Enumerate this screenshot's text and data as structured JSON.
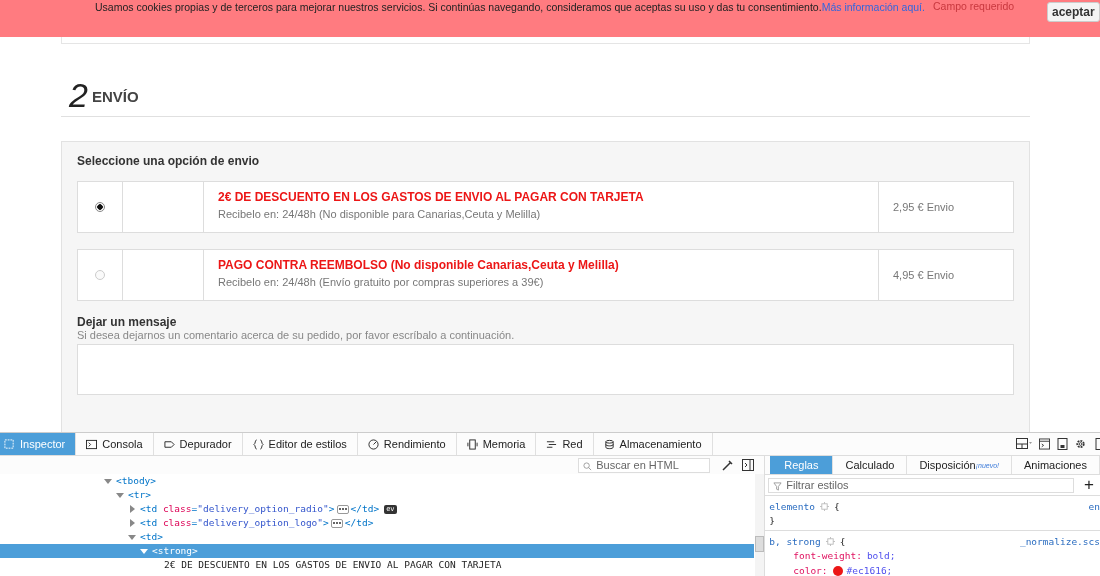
{
  "cookie_bar": {
    "message": "Usamos cookies propias y de terceros para mejorar nuestros servicios. Si continúas navegando, consideramos que aceptas su uso y das tu consentimiento.",
    "link": "Más información aquí.",
    "behind_text": "Campo requerido",
    "button": "aceptar"
  },
  "section": {
    "number": "2",
    "title": "ENVÍO"
  },
  "shipping": {
    "heading": "Seleccione una opción de envio",
    "options": [
      {
        "selected": true,
        "title": "2€ DE DESCUENTO EN LOS GASTOS DE ENVIO AL PAGAR CON TARJETA",
        "subtitle": "Recibelo en: 24/48h (No disponible para Canarias,Ceuta y Melilla)",
        "price": "2,95 € Envio"
      },
      {
        "selected": false,
        "title": "PAGO CONTRA REEMBOLSO (No disponible Canarias,Ceuta y Melilla)",
        "subtitle": "Recibelo en: 24/48h (Envío gratuito por compras superiores a 39€)",
        "price": "4,95 € Envio"
      }
    ],
    "message_label": "Dejar un mensaje",
    "message_hint": "Si desea dejarnos un comentario acerca de su pedido, por favor escríbalo a continuación."
  },
  "devtools": {
    "tabs": [
      {
        "label": "Inspector",
        "selected": true
      },
      {
        "label": "Consola",
        "selected": false
      },
      {
        "label": "Depurador",
        "selected": false
      },
      {
        "label": "Editor de estilos",
        "selected": false
      },
      {
        "label": "Rendimiento",
        "selected": false
      },
      {
        "label": "Memoria",
        "selected": false
      },
      {
        "label": "Red",
        "selected": false
      },
      {
        "label": "Almacenamiento",
        "selected": false
      }
    ],
    "search_placeholder": "Buscar en HTML",
    "dom": [
      {
        "tokens": [
          {
            "kind": "tag",
            "text": "<tbody>"
          }
        ],
        "expanded": true,
        "selected": false,
        "children": [
          {
            "tokens": [
              {
                "kind": "tag",
                "text": "<tr>"
              }
            ],
            "expanded": true,
            "selected": false,
            "children": [
              {
                "tokens": [
                  {
                    "kind": "tag",
                    "text": "<td"
                  },
                  {
                    "kind": "attr",
                    "text": "class"
                  },
                  {
                    "kind": "punct",
                    "text": "="
                  },
                  {
                    "kind": "value",
                    "text": "\"delivery_option_radio\""
                  },
                  {
                    "kind": "tag",
                    "text": ">"
                  }
                ],
                "expanded": false,
                "selected": false,
                "end": "</td>",
                "badge": "ev"
              },
              {
                "tokens": [
                  {
                    "kind": "tag",
                    "text": "<td"
                  },
                  {
                    "kind": "attr",
                    "text": "class"
                  },
                  {
                    "kind": "punct",
                    "text": "="
                  },
                  {
                    "kind": "value",
                    "text": "\"delivery_option_logo\""
                  },
                  {
                    "kind": "tag",
                    "text": ">"
                  }
                ],
                "expanded": false,
                "selected": false,
                "end": "</td>"
              },
              {
                "tokens": [
                  {
                    "kind": "tag",
                    "text": "<td>"
                  }
                ],
                "expanded": true,
                "selected": false,
                "children": [
                  {
                    "tokens": [
                      {
                        "kind": "tag",
                        "text": "<strong>"
                      }
                    ],
                    "expanded": true,
                    "selected": true,
                    "children": [
                      {
                        "tokens": [
                          {
                            "kind": "text",
                            "text": "2€ DE DESCUENTO EN LOS GASTOS DE ENVIO AL PAGAR CON TARJETA"
                          }
                        ],
                        "selected": false
                      }
                    ]
                  }
                ]
              }
            ]
          }
        ]
      }
    ],
    "sidebar_tabs": [
      {
        "label": "Reglas",
        "selected": true
      },
      {
        "label": "Calculado",
        "selected": false
      },
      {
        "label": "Disposición",
        "badge": "¡nuevo!",
        "selected": false
      },
      {
        "label": "Animaciones",
        "selected": false
      }
    ],
    "filter_placeholder": "Filtrar estilos",
    "add_button": "+",
    "rules": [
      {
        "selector": "elemento",
        "open": "{",
        "source": "en",
        "close": "}"
      },
      {
        "selector": "b, strong",
        "open": "{",
        "source": "_normalize.scs",
        "declarations": [
          {
            "property": "font-weight:",
            "value": "bold;"
          },
          {
            "property": "color:",
            "value": "#ec1616;",
            "color": "#ec1616"
          }
        ]
      }
    ]
  }
}
